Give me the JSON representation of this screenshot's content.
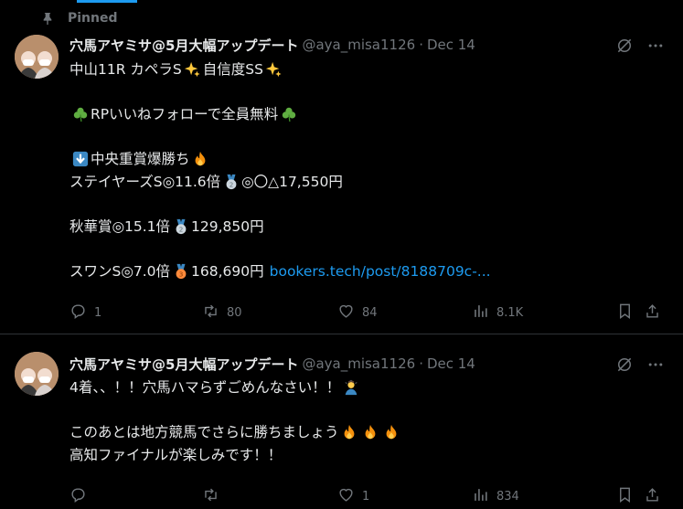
{
  "pinned_label": "Pinned",
  "tweets": [
    {
      "name": "穴馬アヤミサ@5月大幅アップデート",
      "handle": "@aya_misa1126",
      "separator": "·",
      "date": "Dec 14",
      "lines": {
        "l1": "中山11R カペラS",
        "l1b": "自信度SS",
        "l2": "RPいいねフォローで全員無料",
        "l3": "中央重賞爆勝ち",
        "l4a": "ステイヤーズS◎11.6倍",
        "l4b": "◎〇△17,550円",
        "l5a": "秋華賞◎15.1倍",
        "l5b": "129,850円",
        "l6a": "スワンS◎7.0倍",
        "l6b": "168,690円",
        "link": "bookers.tech/post/8188709c-..."
      },
      "stats": {
        "replies": "1",
        "retweets": "80",
        "likes": "84",
        "views": "8.1K"
      }
    },
    {
      "name": "穴馬アヤミサ@5月大幅アップデート",
      "handle": "@aya_misa1126",
      "separator": "·",
      "date": "Dec 14",
      "lines": {
        "l1": "4着、、！！穴馬ハマらずごめんなさい！！",
        "l2": "このあとは地方競馬でさらに勝ちましょう",
        "l3": "高知ファイナルが楽しみです！！"
      },
      "stats": {
        "replies": "",
        "retweets": "",
        "likes": "1",
        "views": "834"
      }
    }
  ],
  "colors": {
    "accent": "#1d9bf0",
    "muted": "#71767b",
    "text": "#e7e9ea",
    "border": "#2f3336",
    "background": "#000000"
  },
  "icons": [
    "pin-icon",
    "grok-icon",
    "more-icon",
    "reply-icon",
    "retweet-icon",
    "like-icon",
    "views-icon",
    "bookmark-icon",
    "share-icon",
    "sparkles-icon",
    "shamrock-icon",
    "down-arrow-icon",
    "fire-icon",
    "silver-medal-icon",
    "bronze-medal-icon",
    "person-bowing-icon"
  ]
}
